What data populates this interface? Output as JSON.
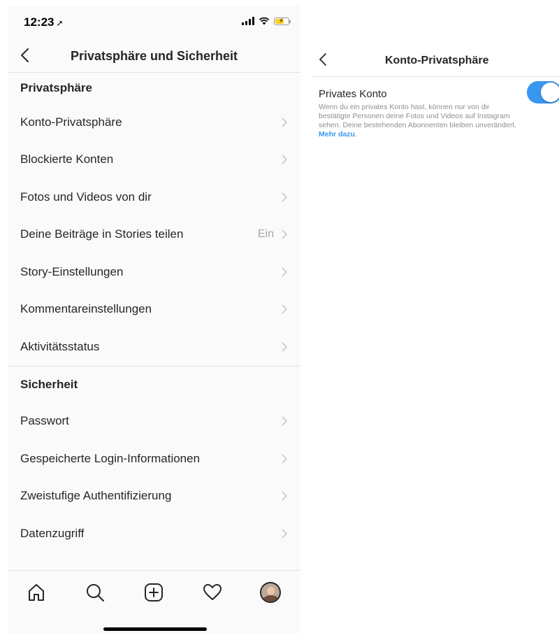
{
  "status_bar": {
    "time": "12:23",
    "location_arrow": "location-arrow-icon"
  },
  "header": {
    "title": "Privatsphäre und Sicherheit"
  },
  "sections": [
    {
      "title": "Privatsphäre",
      "items": [
        {
          "label": "Konto-Privatsphäre"
        },
        {
          "label": "Blockierte Konten"
        },
        {
          "label": "Fotos und Videos von dir"
        },
        {
          "label": "Deine Beiträge in Stories teilen",
          "value": "Ein"
        },
        {
          "label": "Story-Einstellungen"
        },
        {
          "label": "Kommentareinstellungen"
        },
        {
          "label": "Aktivitätsstatus"
        }
      ]
    },
    {
      "title": "Sicherheit",
      "items": [
        {
          "label": "Passwort"
        },
        {
          "label": "Gespeicherte Login-Informationen"
        },
        {
          "label": "Zweistufige Authentifizierung"
        },
        {
          "label": "Datenzugriff"
        }
      ]
    }
  ],
  "tab_bar": {
    "icons": [
      "home-icon",
      "search-icon",
      "add-post-icon",
      "heart-icon",
      "profile-avatar"
    ]
  },
  "account_privacy": {
    "title": "Konto-Privatsphäre",
    "setting_label": "Privates Konto",
    "description": "Wenn du ein privates Konto hast, können nur von dir bestätigte Personen deine Fotos und Videos auf Instagram sehen. Deine bestehenden Abonnenten bleiben unverändert.",
    "link": "Mehr dazu",
    "toggle_on": true
  },
  "colors": {
    "accent": "#3897f0",
    "battery": "#ffd21f",
    "text": "#262626",
    "secondary": "#8e8e8e"
  }
}
